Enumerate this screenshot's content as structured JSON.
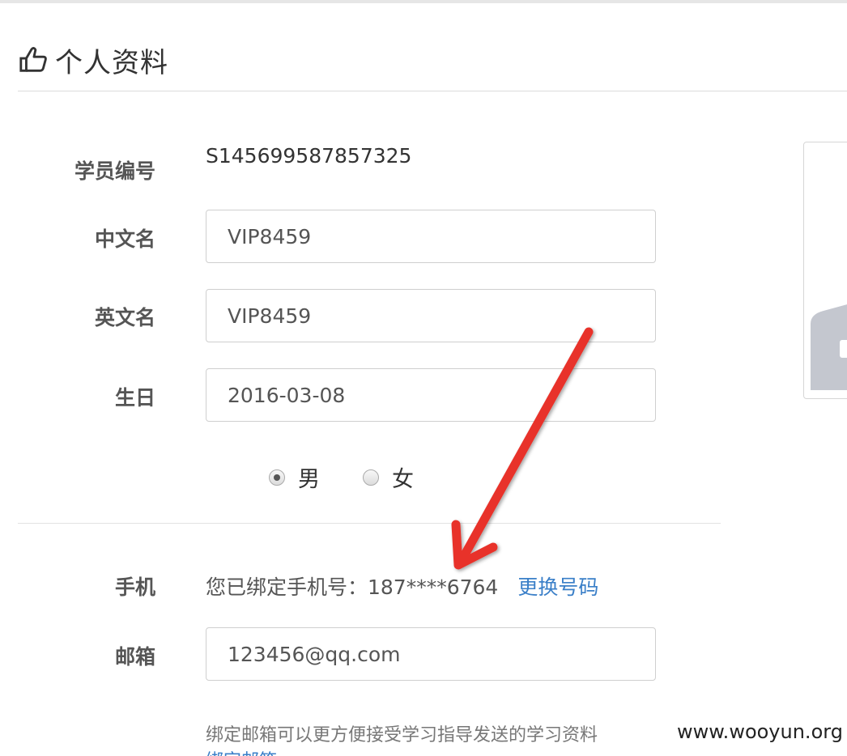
{
  "page": {
    "title": "个人资料",
    "title_icon": "thumbs-up-icon"
  },
  "profile": {
    "student_id_label": "学员编号",
    "student_id": "S145699587857325",
    "chinese_name_label": "中文名",
    "chinese_name": "VIP8459",
    "english_name_label": "英文名",
    "english_name": "VIP8459",
    "birthday_label": "生日",
    "birthday": "2016-03-08",
    "gender_options": [
      "男",
      "女"
    ],
    "gender_selected": "男"
  },
  "contact": {
    "phone_label": "手机",
    "phone_text": "您已绑定手机号：187****6764",
    "change_phone_link": "更换号码",
    "email_label": "邮箱",
    "email": "123456@qq.com",
    "email_hint": "绑定邮箱可以更方便接受学习指导发送的学习资料",
    "bind_email_link": "绑定邮箱"
  },
  "annotation": {
    "arrow_color": "#e8332a"
  },
  "watermark": "www.wooyun.org",
  "colors": {
    "link": "#3a7fc8",
    "label": "#555555",
    "border": "#cfcfcf"
  }
}
